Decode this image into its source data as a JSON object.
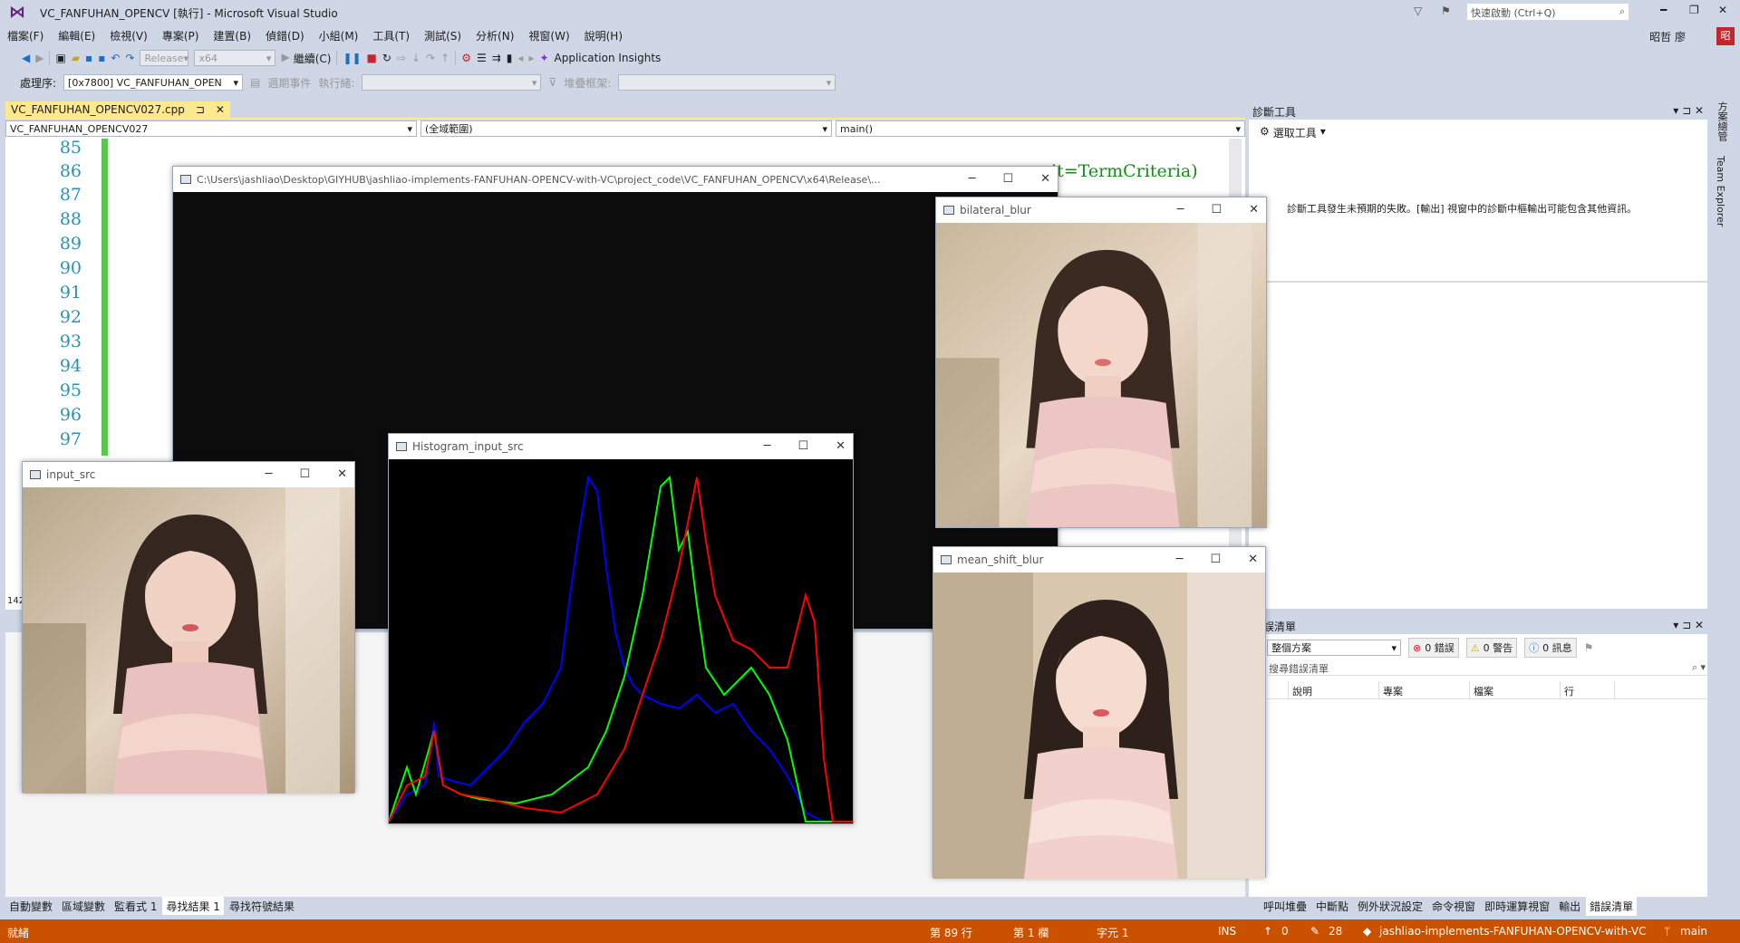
{
  "titlebar": {
    "title": "VC_FANFUHAN_OPENCV [執行] - Microsoft Visual Studio",
    "quick_launch_placeholder": "快速啟動 (Ctrl+Q)"
  },
  "menu": [
    "檔案(F)",
    "編輯(E)",
    "檢視(V)",
    "專案(P)",
    "建置(B)",
    "偵錯(D)",
    "小組(M)",
    "工具(T)",
    "測試(S)",
    "分析(N)",
    "視窗(W)",
    "說明(H)"
  ],
  "user": {
    "name": "昭哲 廖",
    "avatar": "昭"
  },
  "toolbar": {
    "config": "Release",
    "platform": "x64",
    "continue_label": "繼續(C)",
    "app_insights": "Application Insights"
  },
  "toolbar2": {
    "process_label": "處理序:",
    "process_value": "[0x7800] VC_FANFUHAN_OPEN",
    "lifecycle_label": "週期事件",
    "thread_label": "執行緒:",
    "stack_label": "堆疊框架:"
  },
  "editor": {
    "tab_label": "VC_FANFUHAN_OPENCV027.cpp",
    "nav_project": "VC_FANFUHAN_OPENCV027",
    "nav_scope": "(全域範圍)",
    "nav_function": "main()",
    "line_numbers": [
      "85",
      "86",
      "87",
      "88",
      "89",
      "90",
      "91",
      "92",
      "93",
      "94",
      "95",
      "96",
      "97"
    ],
    "code_fragment": "it=TermCriteria)",
    "zoom_partial": "142"
  },
  "bottom_tabs": [
    "自動變數",
    "區域變數",
    "監看式 1",
    "尋找結果 1",
    "尋找符號結果"
  ],
  "diagnostics": {
    "title": "診斷工具",
    "select_tools": "選取工具",
    "message": "診斷工具發生未預期的失敗。[輸出] 視窗中的診斷中樞輸出可能包含其他資訊。"
  },
  "side_labels": [
    "方案總管",
    "Team Explorer"
  ],
  "error_list": {
    "title": "錯誤清單",
    "scope": "整個方案",
    "errors": "0 錯誤",
    "warnings": "0 警告",
    "messages": "0 訊息",
    "search_placeholder": "搜尋錯誤清單",
    "columns": [
      "說明",
      "專案",
      "檔案",
      "行"
    ]
  },
  "right_tabs": [
    "呼叫堆疊",
    "中斷點",
    "例外狀況設定",
    "命令視窗",
    "即時運算視窗",
    "輸出",
    "錯誤清單"
  ],
  "statusbar": {
    "ready": "就緒",
    "line": "第 89 行",
    "col": "第 1 欄",
    "char": "字元 1",
    "ins": "INS",
    "up": "0",
    "edits": "28",
    "repo": "jashliao-implements-FANFUHAN-OPENCV-with-VC",
    "branch": "main"
  },
  "windows": {
    "console": "C:\\Users\\jashliao\\Desktop\\GIYHUB\\jashliao-implements-FANFUHAN-OPENCV-with-VC\\project_code\\VC_FANFUHAN_OPENCV\\x64\\Release\\...",
    "bilateral": "bilateral_blur",
    "histogram": "Histogram_input_src",
    "input": "input_src",
    "meanshift": "mean_shift_blur"
  },
  "colors": {
    "status_bg": "#ca5100",
    "tab_active": "#ffe98f",
    "chrome": "#cfd6e5",
    "hist_blue": "#0000ff",
    "hist_green": "#00ff00",
    "hist_red": "#ff0000"
  }
}
